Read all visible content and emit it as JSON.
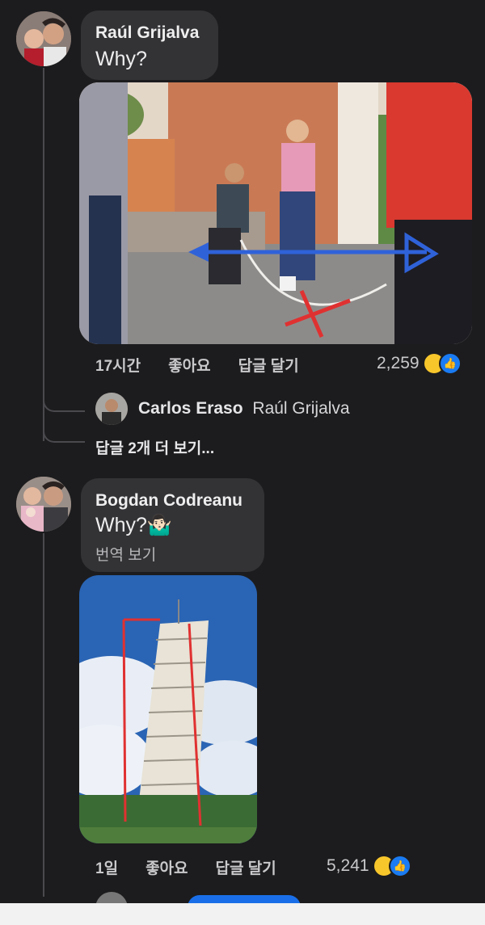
{
  "comments": [
    {
      "author": "Raúl Grijalva",
      "text": "Why?",
      "time": "17시간",
      "like": "좋아요",
      "reply": "답글 달기",
      "reaction_count": "2,259"
    },
    {
      "author": "Bogdan Codreanu",
      "text": "Why?🤷🏻‍♂️",
      "translate": "번역 보기",
      "time": "1일",
      "like": "좋아요",
      "reply": "답글 달기",
      "reaction_count": "5,241"
    }
  ],
  "reply_preview": {
    "author": "Carlos Eraso",
    "mention": "Raúl Grijalva"
  },
  "more_replies": "답글 2개 더 보기...",
  "colors": {
    "background": "#1c1c1e",
    "bubble": "#333336",
    "haha": "#f7c62b",
    "like": "#1a7bf2"
  }
}
